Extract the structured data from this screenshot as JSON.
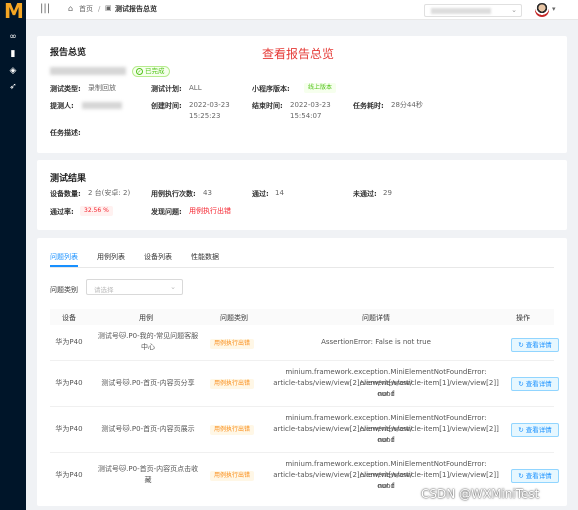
{
  "logo": {
    "letter": "M"
  },
  "breadcrumb": {
    "home": "首页",
    "current": "测试报告总览"
  },
  "overview": {
    "title": "报告总览",
    "heading": "查看报告总览",
    "status": "已完成",
    "fields": {
      "test_type_label": "测试类型:",
      "test_type": "录制回放",
      "test_plan_label": "测试计划:",
      "test_plan": "ALL",
      "mini_version_label": "小程序版本:",
      "mini_version": "线上版本",
      "submitter_label": "提测人:",
      "created_label": "创建时间:",
      "created_date": "2022-03-23",
      "created_time": "15:25:23",
      "ended_label": "结束时间:",
      "ended_date": "2022-03-23",
      "ended_time": "15:54:07",
      "duration_label": "任务耗时:",
      "duration": "28分44秒",
      "desc_label": "任务描述:"
    }
  },
  "results": {
    "title": "测试结果",
    "device_count_label": "设备数量:",
    "device_count": "2 台(安卓: 2)",
    "case_runs_label": "用例执行次数:",
    "case_runs": "43",
    "passed_label": "通过:",
    "passed": "14",
    "failed_label": "未通过:",
    "failed": "29",
    "pass_rate_label": "通过率:",
    "pass_rate": "32.56 %",
    "issues_label": "发现问题:",
    "issues_link": "用例执行出错"
  },
  "tabs": [
    "问题列表",
    "用例列表",
    "设备列表",
    "性能数据"
  ],
  "filter": {
    "label": "问题类别",
    "placeholder": "请选择"
  },
  "table": {
    "headers": [
      "设备",
      "用例",
      "问题类别",
      "问题详情",
      "操作"
    ],
    "rows": [
      {
        "device": "华为P40",
        "case_1": "测试号🐱.P0-我的-常见问题客服",
        "case_2": "中心",
        "category": "用例执行出错",
        "detail_1": "AssertionError: False is not true",
        "detail_2": "",
        "detail_3": "",
        "action": "查看详情"
      },
      {
        "device": "华为P40",
        "case_1": "测试号🐱.P0-首页-内容页分享",
        "case_2": "",
        "category": "用例执行出错",
        "detail_1": "minium.framework.exception.MiniElementNotFoundError: element[/view/",
        "detail_2": "article-tabs/view/view[2]/view/view/article-item[1]/view/view[2]] not f",
        "detail_3": "ound",
        "action": "查看详情"
      },
      {
        "device": "华为P40",
        "case_1": "测试号🐱.P0-首页-内容页展示",
        "case_2": "",
        "category": "用例执行出错",
        "detail_1": "minium.framework.exception.MiniElementNotFoundError: element[/view/",
        "detail_2": "article-tabs/view/view[2]/view/view/article-item[1]/view/view[2]] not f",
        "detail_3": "ound",
        "action": "查看详情"
      },
      {
        "device": "华为P40",
        "case_1": "测试号🐱.P0-首页-内容页点击收",
        "case_2": "藏",
        "category": "用例执行出错",
        "detail_1": "minium.framework.exception.MiniElementNotFoundError: element[/view/",
        "detail_2": "article-tabs/view/view[2]/view/view/article-item[1]/view/view[2]] not f",
        "detail_3": "ound",
        "action": "查看详情"
      }
    ]
  },
  "watermark": "CSDN @WXMiniTest"
}
